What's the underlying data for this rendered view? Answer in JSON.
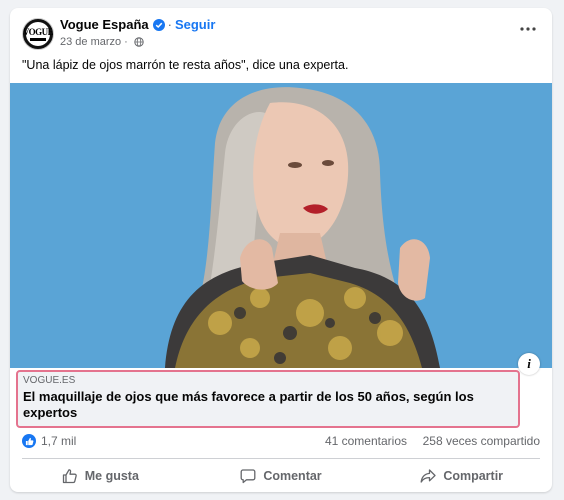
{
  "post": {
    "page_name": "Vogue España",
    "separator": "·",
    "follow_label": "Seguir",
    "date": "23 de marzo",
    "caption": "\"Una lápiz de ojos marrón te resta años\", dice una experta.",
    "avatar_text": "VOGUE"
  },
  "link": {
    "domain": "VOGUE.ES",
    "title": "El maquillaje de ojos que más favorece a partir de los 50 años, según los expertos",
    "info_label": "i"
  },
  "stats": {
    "reactions": "1,7 mil",
    "comments": "41 comentarios",
    "shares": "258 veces compartido"
  },
  "actions": {
    "like_label": "Me gusta",
    "comment_label": "Comentar",
    "share_label": "Compartir"
  },
  "icons": {
    "verified": "verified-badge-icon",
    "audience": "globe-icon",
    "more": "more-options-icon",
    "like": "thumbs-up-icon",
    "comment": "comment-bubble-icon",
    "share": "share-arrow-icon"
  },
  "colors": {
    "accent": "#1877f2",
    "photo_background": "#5aa4d6",
    "link_highlight": "#e4738e",
    "secondary_text": "#65676b"
  }
}
